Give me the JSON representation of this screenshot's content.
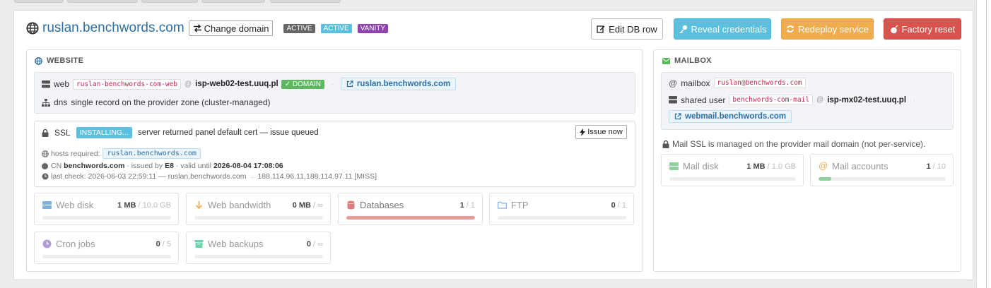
{
  "header": {
    "title": "ruslan.benchwords.com",
    "change_domain": "Change domain",
    "badges": [
      "ACTIVE",
      "ACTIVE",
      "VANITY"
    ]
  },
  "actions": {
    "edit": "Edit DB row",
    "reveal": "Reveal credentials",
    "redeploy": "Redeploy service",
    "reset": "Factory reset"
  },
  "website": {
    "title": "WEBSITE",
    "web_label": "web",
    "web_user": "ruslan-benchwords-com-web",
    "at": "@",
    "web_host": "isp-web02-test.uuq.pl",
    "domain_badge": "DOMAIN",
    "sep": "·",
    "web_link": "ruslan.benchwords.com",
    "dns_label": "dns",
    "dns_text": "single record on the provider zone (cluster-managed)",
    "ssl": {
      "label": "SSL",
      "status": "INSTALLING...",
      "message": "server returned panel default cert — issue queued",
      "issue_button": "Issue now",
      "hosts_label": "hosts required:",
      "hosts_value": "ruslan.benchwords.com",
      "cn_label": "CN",
      "cn_value": "benchwords.com",
      "issued_by_label": "· issued by",
      "issued_by": "E8",
      "valid_label": "· valid until",
      "valid_until": "2026-08-04 17:08:06",
      "last_check": "last check: 2026-06-03 22:59:11 — ruslan.benchwords.com",
      "arrow": "→",
      "ips": "188.114.96.11,188.114.97.11 [MISS]"
    },
    "stats": [
      {
        "label": "Web disk",
        "used": "1 MB",
        "limit": "/ 10.0 GB",
        "fraction": 0.0,
        "color": "#5b9bd5"
      },
      {
        "label": "Web bandwidth",
        "used": "0 MB",
        "limit": "/ ∞",
        "fraction": 0.0,
        "color": "#f0ad4e"
      },
      {
        "label": "Databases",
        "used": "1",
        "limit": "/ 1",
        "fraction": 1.0,
        "color": "#e89b9b"
      },
      {
        "label": "FTP",
        "used": "0",
        "limit": "/ 1",
        "fraction": 0.0,
        "color": "#5b9bd5"
      },
      {
        "label": "Cron jobs",
        "used": "0",
        "limit": "/ 5",
        "fraction": 0.0,
        "color": "#a988d0"
      },
      {
        "label": "Web backups",
        "used": "0",
        "limit": "/ ∞",
        "fraction": 0.0,
        "color": "#5cc8a0"
      }
    ]
  },
  "mailbox": {
    "title": "MAILBOX",
    "mailbox_label": "mailbox",
    "mailbox_value": "ruslan@benchwords.com",
    "shared_label": "shared user",
    "shared_value": "benchwords-com-mail",
    "at": "@",
    "mx_host": "isp-mx02-test.uuq.pl",
    "sep": "·",
    "webmail": "webmail.benchwords.com",
    "ssl_note": "Mail SSL is managed on the provider mail domain (not per-service).",
    "stats": [
      {
        "label": "Mail disk",
        "used": "1 MB",
        "limit": "/ 1.0 GB",
        "fraction": 0.0,
        "color": "#5cb85c"
      },
      {
        "label": "Mail accounts",
        "used": "1",
        "limit": "/ 10",
        "fraction": 0.1,
        "color": "#8fd19e"
      }
    ]
  },
  "colors": {
    "accent": "#2c6fa6",
    "info": "#5bc0de",
    "warning": "#f0ad4e",
    "danger": "#d9534f",
    "success": "#5cb85c"
  }
}
